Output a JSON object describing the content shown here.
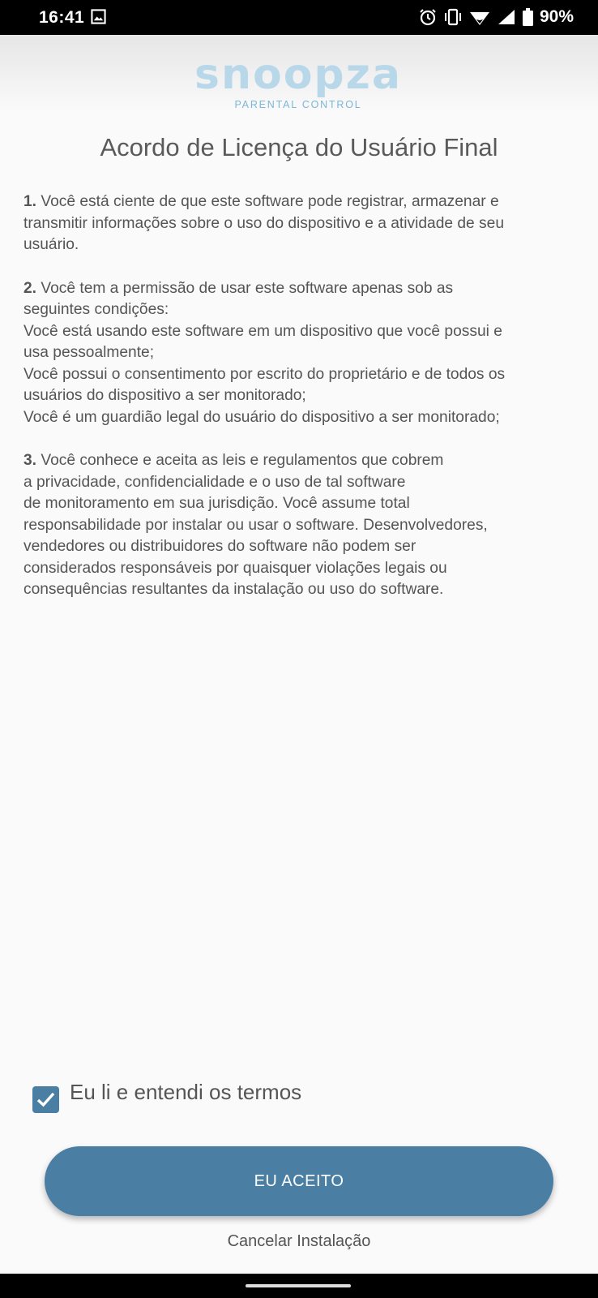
{
  "status_bar": {
    "time": "16:41",
    "battery": "90%",
    "icons": [
      "image-icon",
      "alarm-icon",
      "vibrate-icon",
      "wifi-icon",
      "signal-icon",
      "battery-icon"
    ]
  },
  "logo": {
    "wordmark": "snoopza",
    "tagline": "PARENTAL CONTROL",
    "color": "#b8d8ea"
  },
  "title": "Acordo de Licença do Usuário Final",
  "terms": {
    "item1": {
      "num": "1.",
      "lines": [
        "Você está ciente de que este software pode registrar, armazenar e",
        "transmitir informações sobre o uso do dispositivo e a atividade de seu",
        "usuário."
      ]
    },
    "item2": {
      "num": "2.",
      "lines": [
        "Você tem a permissão de usar este software apenas sob as",
        "seguintes condições:",
        "Você está usando este software em um dispositivo que você possui e",
        "usa pessoalmente;",
        "Você possui o consentimento por escrito do proprietário e de todos os",
        "usuários do dispositivo a ser monitorado;",
        "Você é um guardião legal do usuário do dispositivo a ser monitorado;"
      ]
    },
    "item3": {
      "num": "3.",
      "lines": [
        "Você conhece e aceita as leis e regulamentos que cobrem",
        "a privacidade, confidencialidade e o uso de tal software",
        "de monitoramento em sua jurisdição. Você assume total",
        "responsabilidade por instalar ou usar o software. Desenvolvedores,",
        "vendedores ou distribuidores do software não podem ser",
        "considerados responsáveis por quaisquer violações legais ou",
        "consequências resultantes da instalação ou uso do software."
      ]
    }
  },
  "agreement": {
    "label": "Eu li e entendi os termos",
    "checked": true
  },
  "buttons": {
    "accept": "EU ACEITO",
    "cancel": "Cancelar Instalação"
  },
  "colors": {
    "accent": "#4a7fa3",
    "background": "#fafafa",
    "text": "#555555"
  }
}
